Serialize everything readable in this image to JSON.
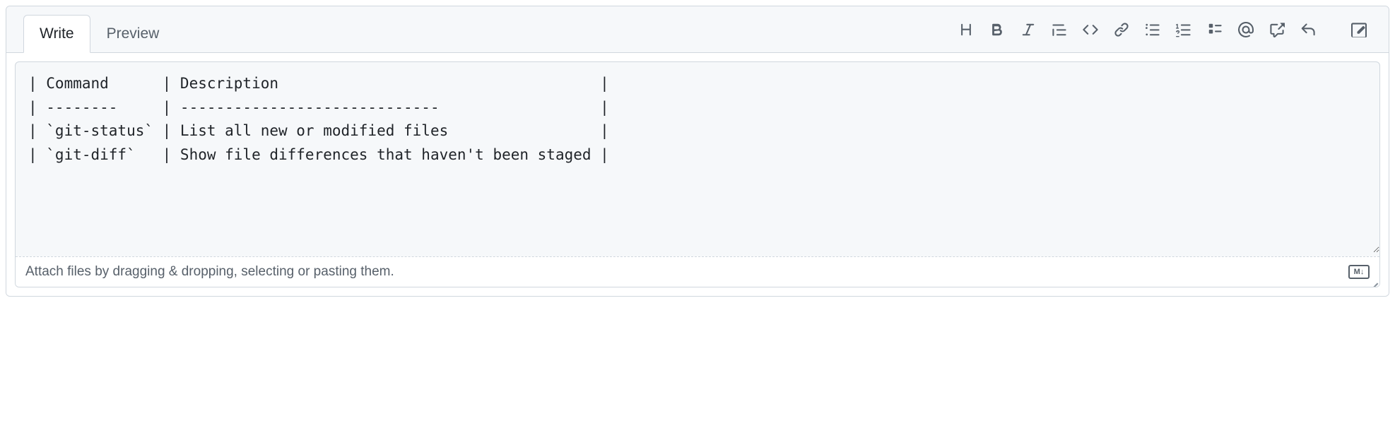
{
  "tabs": {
    "write": "Write",
    "preview": "Preview"
  },
  "editor": {
    "content": "| Command      | Description                                    |\n| --------     | -----------------------------                  |\n| `git-status` | List all new or modified files                 |\n| `git-diff`   | Show file differences that haven't been staged |"
  },
  "attach_hint": "Attach files by dragging & dropping, selecting or pasting them.",
  "markdown_badge": "M↓",
  "toolbar_items": [
    "heading",
    "bold",
    "italic",
    "quote",
    "code",
    "link",
    "unordered-list",
    "ordered-list",
    "task-list",
    "mention",
    "cross-reference",
    "reply",
    "suggestion"
  ]
}
